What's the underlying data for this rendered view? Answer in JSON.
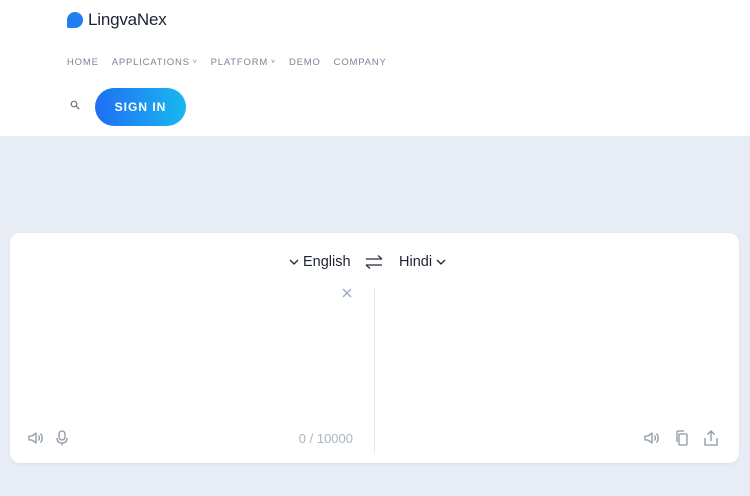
{
  "brand": {
    "name_part1": "Lingva",
    "name_part2": "Nex",
    "color": "#1f7ef2"
  },
  "nav": {
    "items": [
      {
        "label": "HOME",
        "dropdown": false
      },
      {
        "label": "APPLICATIONS",
        "dropdown": true
      },
      {
        "label": "PLATFORM",
        "dropdown": true
      },
      {
        "label": "DEMO",
        "dropdown": false
      },
      {
        "label": "COMPANY",
        "dropdown": false
      }
    ],
    "dropdown_glyph": "˅"
  },
  "header": {
    "search_icon": "search-icon",
    "signin_label": "SIGN IN"
  },
  "translator": {
    "source_lang": "English",
    "target_lang": "Hindi",
    "char_count": "0 / 10000",
    "icons": {
      "source": [
        "speaker-icon",
        "microphone-icon"
      ],
      "target": [
        "speaker-icon",
        "copy-icon",
        "share-icon"
      ],
      "swap": "swap-arrows-icon",
      "clear": "close-icon"
    }
  },
  "colors": {
    "accent_start": "#1f6ff2",
    "accent_end": "#18b8f0",
    "page_bg": "#e8edf5",
    "icon_gray": "#9aa4b2"
  }
}
